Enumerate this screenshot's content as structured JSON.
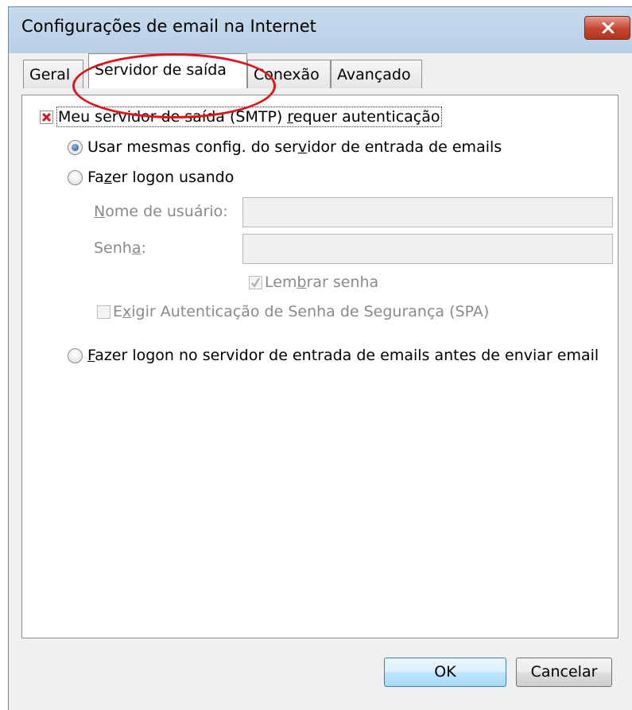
{
  "window": {
    "title": "Configurações de email na Internet"
  },
  "tabs": [
    {
      "label": "Geral",
      "active": false
    },
    {
      "label": "Servidor de saída",
      "active": true
    },
    {
      "label": "Conexão",
      "active": false
    },
    {
      "label": "Avançado",
      "active": false
    }
  ],
  "smtp_auth": {
    "label_pre": "Meu servidor de saída (SMTP) ",
    "label_u": "r",
    "label_post": "equer autenticação",
    "checked": true
  },
  "radio_same": {
    "label_pre": "Usar mesmas config. do ser",
    "label_u": "v",
    "label_post": "idor de entrada de emails",
    "selected": true
  },
  "radio_logon": {
    "label_pre": "Fa",
    "label_u": "z",
    "label_post": "er logon usando",
    "selected": false
  },
  "username": {
    "label_u": "N",
    "label_post": "ome de usuário:",
    "value": ""
  },
  "password": {
    "label_pre": "Senh",
    "label_u": "a",
    "label_post": ":",
    "value": ""
  },
  "remember": {
    "label_pre": "Lem",
    "label_u": "b",
    "label_post": "rar senha",
    "checked": true
  },
  "spa": {
    "label_pre": "E",
    "label_u": "x",
    "label_post": "igir Autenticação de Senha de Segurança (SPA)",
    "checked": false
  },
  "radio_before": {
    "label_u": "F",
    "label_post": "azer logon no servidor de entrada de emails antes de enviar email",
    "selected": false
  },
  "buttons": {
    "ok": "OK",
    "cancel": "Cancelar"
  },
  "colors": {
    "annotation": "#e0121b",
    "titlebar": "#c6daed",
    "close": "#c4452f"
  },
  "icons": {
    "close": "close-icon",
    "checkbox_x": "red-x-check-icon",
    "checkmark": "checkmark-icon"
  }
}
